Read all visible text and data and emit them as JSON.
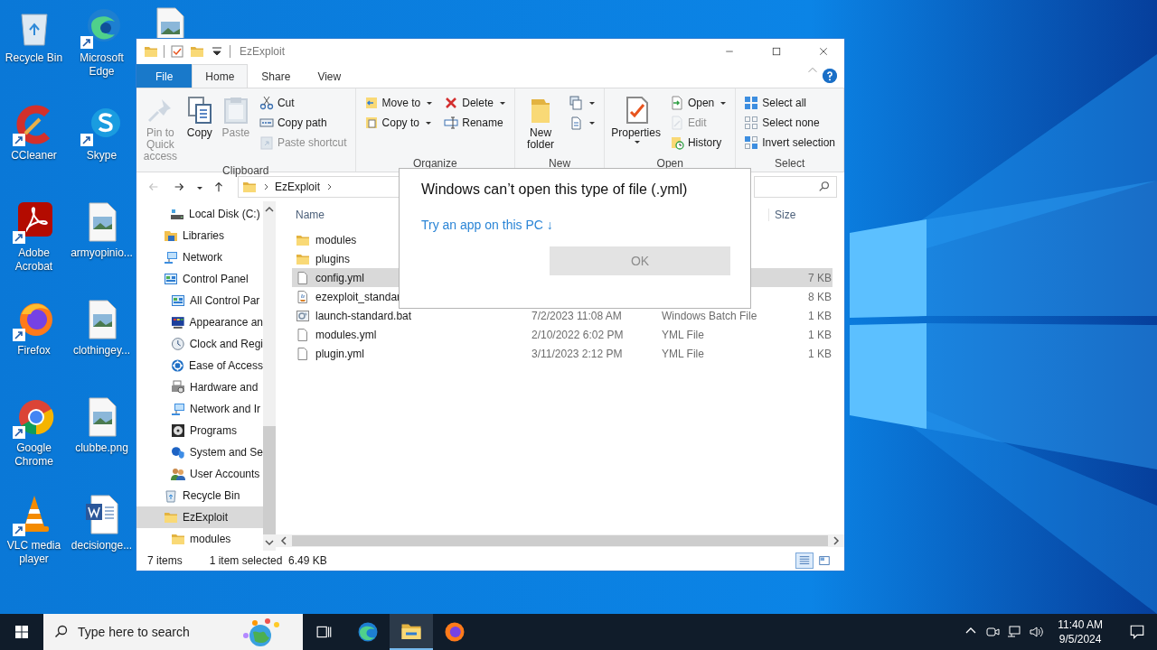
{
  "desktop": {
    "columns": [
      [
        {
          "label": "Recycle Bin",
          "kind": "recycle-bin",
          "shortcut": false
        },
        {
          "label": "CCleaner",
          "kind": "ccleaner",
          "shortcut": true
        },
        {
          "label": "Adobe Acrobat",
          "kind": "acrobat",
          "shortcut": true
        },
        {
          "label": "Firefox",
          "kind": "firefox",
          "shortcut": true
        },
        {
          "label": "Google Chrome",
          "kind": "chrome",
          "shortcut": true
        },
        {
          "label": "VLC media player",
          "kind": "vlc",
          "shortcut": true
        }
      ],
      [
        {
          "label": "Microsoft Edge",
          "kind": "edge",
          "shortcut": true
        },
        {
          "label": "Skype",
          "kind": "skype",
          "shortcut": true
        },
        {
          "label": "armyopinio...",
          "kind": "image-file",
          "shortcut": false
        },
        {
          "label": "clothingey...",
          "kind": "image-file",
          "shortcut": false
        },
        {
          "label": "clubbe.png",
          "kind": "image-file",
          "shortcut": false
        },
        {
          "label": "decisionge...",
          "kind": "word-doc",
          "shortcut": false
        }
      ],
      [
        {
          "kind": "image-file",
          "shortcut": false
        }
      ]
    ]
  },
  "explorer": {
    "title": "EzExploit",
    "tabs": [
      {
        "label": "File",
        "kind": "file-menu",
        "selected": false
      },
      {
        "label": "Home",
        "kind": "tab",
        "selected": true
      },
      {
        "label": "Share",
        "kind": "tab",
        "selected": false
      },
      {
        "label": "View",
        "kind": "tab",
        "selected": false
      }
    ],
    "ribbon": [
      {
        "label": "Clipboard",
        "items": [
          {
            "label": "Pin to Quick access",
            "kind": "pin",
            "disabled": true,
            "dropdown": false
          },
          {
            "label": "Copy",
            "kind": "copy",
            "disabled": false,
            "dropdown": false
          },
          {
            "label": "Paste",
            "kind": "paste",
            "disabled": true,
            "dropdown": false
          },
          {
            "items": [
              {
                "label": "Cut",
                "kind": "cut",
                "disabled": false,
                "dropdown": false
              },
              {
                "label": "Copy path",
                "kind": "copy-path",
                "disabled": false,
                "dropdown": false
              },
              {
                "label": "Paste shortcut",
                "kind": "paste-shortcut",
                "disabled": true,
                "dropdown": false
              }
            ]
          }
        ]
      },
      {
        "label": "Organize",
        "items": [
          {
            "items": [
              {
                "label": "Move to",
                "kind": "move-to",
                "disabled": false,
                "dropdown": true
              },
              {
                "label": "Copy to",
                "kind": "copy-to",
                "disabled": false,
                "dropdown": true
              }
            ]
          },
          {
            "items": [
              {
                "label": "Delete",
                "kind": "delete",
                "disabled": false,
                "dropdown": true
              },
              {
                "label": "Rename",
                "kind": "rename",
                "disabled": false,
                "dropdown": false
              }
            ]
          }
        ]
      },
      {
        "label": "New",
        "items": [
          {
            "label": "New folder",
            "kind": "new-folder",
            "disabled": false,
            "dropdown": false
          },
          {
            "items": [
              {
                "kind": "new-item",
                "disabled": false,
                "dropdown": true
              },
              {
                "kind": "easy-access",
                "disabled": false,
                "dropdown": true
              }
            ]
          }
        ]
      },
      {
        "label": "Open",
        "items": [
          {
            "label": "Properties",
            "kind": "properties",
            "disabled": false,
            "dropdown": true
          },
          {
            "items": [
              {
                "label": "Open",
                "kind": "open",
                "disabled": false,
                "dropdown": true
              },
              {
                "label": "Edit",
                "kind": "edit",
                "disabled": true,
                "dropdown": false
              },
              {
                "label": "History",
                "kind": "history",
                "disabled": false,
                "dropdown": false
              }
            ]
          }
        ]
      },
      {
        "label": "Select",
        "items": [
          {
            "items": [
              {
                "label": "Select all",
                "kind": "select-all",
                "disabled": false,
                "dropdown": false
              },
              {
                "label": "Select none",
                "kind": "select-none",
                "disabled": false,
                "dropdown": false
              },
              {
                "label": "Invert selection",
                "kind": "invert-selection",
                "disabled": false,
                "dropdown": false
              }
            ]
          }
        ]
      }
    ],
    "address": {
      "back_disabled": true,
      "breadcrumb": [
        "EzExploit"
      ]
    },
    "navigation": {
      "orphan_children": [
        {
          "label": "Local Disk (C:)",
          "kind": "drive",
          "selected": false
        }
      ],
      "items": [
        {
          "label": "Libraries",
          "kind": "libraries",
          "selected": false
        },
        {
          "label": "Network",
          "kind": "network",
          "selected": false
        },
        {
          "label": "Control Panel",
          "kind": "control-panel",
          "selected": false,
          "children": [
            {
              "label": "All Control Par",
              "kind": "control-panel",
              "selected": false
            },
            {
              "label": "Appearance an",
              "kind": "appearance",
              "selected": false
            },
            {
              "label": "Clock and Regi",
              "kind": "clock",
              "selected": false
            },
            {
              "label": "Ease of Access",
              "kind": "ease",
              "selected": false
            },
            {
              "label": "Hardware and",
              "kind": "hardware",
              "selected": false
            },
            {
              "label": "Network and Ir",
              "kind": "network",
              "selected": false
            },
            {
              "label": "Programs",
              "kind": "programs",
              "selected": false
            },
            {
              "label": "System and Se",
              "kind": "system",
              "selected": false
            },
            {
              "label": "User Accounts",
              "kind": "users",
              "selected": false
            }
          ]
        },
        {
          "label": "Recycle Bin",
          "kind": "recycle",
          "selected": false
        },
        {
          "label": "EzExploit",
          "kind": "folder",
          "selected": true,
          "children": [
            {
              "label": "modules",
              "kind": "folder",
              "selected": false
            }
          ]
        }
      ]
    },
    "columns": [
      {
        "label": "Name",
        "kind": "name"
      },
      {
        "label": "Size",
        "kind": "size"
      }
    ],
    "files": [
      {
        "name": "modules",
        "kind": "folder",
        "selected": false
      },
      {
        "name": "plugins",
        "kind": "folder",
        "selected": false
      },
      {
        "name": "config.yml",
        "kind": "file",
        "selected": true,
        "size": "7 KB"
      },
      {
        "name": "ezexploit_standar",
        "kind": "java",
        "selected": false,
        "size": "8 KB"
      },
      {
        "name": "launch-standard.bat",
        "kind": "batch",
        "selected": false,
        "date": "7/2/2023 11:08 AM",
        "type": "Windows Batch File",
        "size": "1 KB"
      },
      {
        "name": "modules.yml",
        "kind": "file",
        "selected": false,
        "date": "2/10/2022 6:02 PM",
        "type": "YML File",
        "size": "1 KB"
      },
      {
        "name": "plugin.yml",
        "kind": "file",
        "selected": false,
        "date": "3/11/2023 2:12 PM",
        "type": "YML File",
        "size": "1 KB"
      }
    ],
    "status": {
      "item_count": "7 items",
      "selection": "1 item selected",
      "selection_size": "6.49 KB",
      "views": [
        {
          "kind": "details",
          "selected": true
        },
        {
          "kind": "tiles",
          "selected": false
        }
      ]
    }
  },
  "dialog": {
    "title": "Windows can’t open this type of file (.yml)",
    "link": "Try an app on this PC",
    "link_arrow": "↓",
    "button": {
      "label": "OK",
      "disabled": true
    }
  },
  "taskbar": {
    "search_placeholder": "Type here to search",
    "apps": [
      {
        "kind": "task-view",
        "active": false
      },
      {
        "kind": "edge",
        "active": false
      },
      {
        "kind": "explorer",
        "active": true
      },
      {
        "kind": "firefox",
        "active": false
      }
    ],
    "time": "11:40 AM",
    "date": "9/5/2024"
  }
}
